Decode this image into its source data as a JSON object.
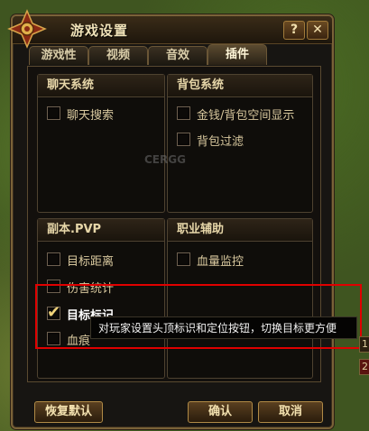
{
  "window": {
    "title": "游戏设置",
    "help_label": "?",
    "close_label": "✕"
  },
  "tabs": [
    {
      "label": "游戏性",
      "active": false
    },
    {
      "label": "视频",
      "active": false
    },
    {
      "label": "音效",
      "active": false
    },
    {
      "label": "插件",
      "active": true
    }
  ],
  "panels": {
    "chat": {
      "title": "聊天系统",
      "options": [
        {
          "label": "聊天搜索",
          "checked": false
        }
      ]
    },
    "bag": {
      "title": "背包系统",
      "options": [
        {
          "label": "金钱/背包空间显示",
          "checked": false
        },
        {
          "label": "背包过滤",
          "checked": false
        }
      ]
    },
    "dungeon": {
      "title": "副本.PVP",
      "options": [
        {
          "label": "目标距离",
          "checked": false
        },
        {
          "label": "伤害统计",
          "checked": false
        },
        {
          "label": "目标标记",
          "checked": true
        },
        {
          "label": "血痕",
          "checked": false
        }
      ]
    },
    "job": {
      "title": "职业辅助",
      "options": [
        {
          "label": "血量监控",
          "checked": false
        }
      ]
    }
  },
  "tooltip": "对玩家设置头顶标识和定位按钮，切换目标更方便",
  "buttons": {
    "reset": "恢复默认",
    "ok": "确认",
    "cancel": "取消"
  },
  "watermark": "CERGG",
  "edge_labels": [
    "1",
    "2"
  ]
}
